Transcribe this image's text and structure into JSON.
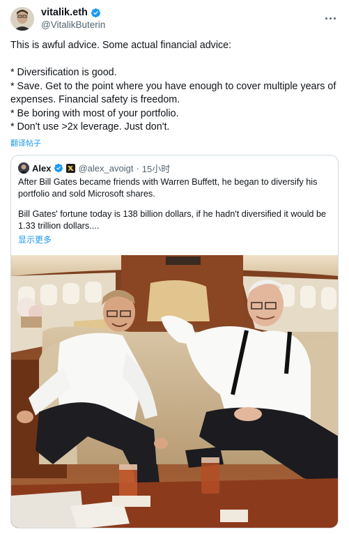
{
  "author": {
    "name": "vitalik.eth",
    "handle": "@VitalikButerin"
  },
  "post": {
    "text": "This is awful advice. Some actual financial advice:\n\n* Diversification is good.\n* Save. Get to the point where you have enough to cover multiple years of expenses. Financial safety is freedom.\n* Be boring with most of your portfolio.\n* Don't use >2x leverage. Just don't.",
    "translate_label": "翻译帖子"
  },
  "quoted_post": {
    "name": "Alex",
    "handle": "@alex_avoigt",
    "time": "15小时",
    "paragraph_1": "After Bill Gates became friends with Warren Buffett, he began to diversify his portfolio and sold Microsoft shares.",
    "paragraph_2": "Bill Gates' fortune today is 138 billion dollars, if he hadn't diversified it would be 1.33 trillion dollars....",
    "show_more_label": "显示更多"
  },
  "colors": {
    "accent": "#1d9bf0",
    "secondary_text": "#536471",
    "border": "#cfd9de"
  },
  "icons": {
    "verified": "verified-badge-icon",
    "more": "more-horizontal-icon",
    "affiliate": "affiliate-badge-icon"
  }
}
